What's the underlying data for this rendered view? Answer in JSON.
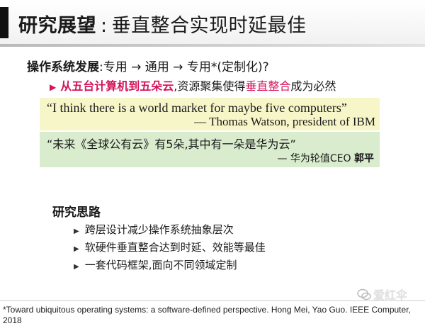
{
  "title": {
    "prefix": "研究展望",
    "separator": ":",
    "subtitle": "垂直整合实现时延最佳"
  },
  "topic": {
    "label": "操作系统发展",
    "text": ":专用 → 通用 → 专用*(定制化)?"
  },
  "bullet": {
    "highlight": "从五台计算机到五朵云",
    "middle": ",资源聚集使得",
    "highlight2": "垂直整合",
    "end": "成为必然"
  },
  "quote_en": {
    "text": "“I think there is a world market for maybe five computers”",
    "attribution": "— Thomas Watson, president of IBM"
  },
  "quote_zh": {
    "text": "“未来《全球公有云》有5朵,其中有一朵是华为云”",
    "attribution_prefix": "— 华为轮值CEO",
    "attribution_name": "郭平"
  },
  "research": {
    "heading": "研究思路",
    "items": [
      "跨层设计减少操作系统抽象层次",
      "软硬件垂直整合达到时延、效能等最佳",
      "一套代码框架,面向不同领域定制"
    ]
  },
  "footnote": "*Toward ubiquitous operating systems: a software-defined perspective.  Hong Mei, Yao Guo. IEEE Computer, 2018",
  "watermark": "爱红伞",
  "colors": {
    "accent_red": "#d4145a",
    "quote_yellow_bg": "#f7f6c9",
    "quote_green_bg": "#d9eccd"
  }
}
